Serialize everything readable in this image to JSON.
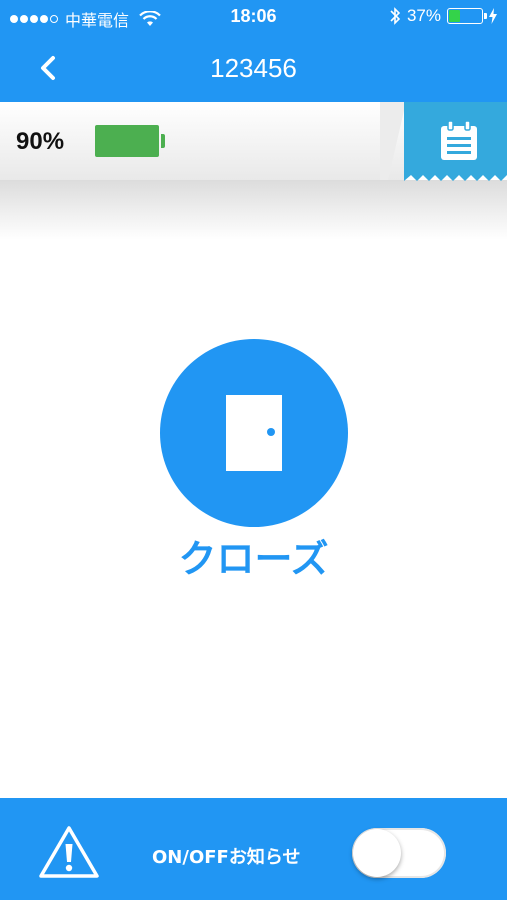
{
  "status_bar": {
    "carrier": "中華電信",
    "time": "18:06",
    "battery_text": "37%",
    "battery_level": 0.37,
    "battery_fill_color": "#34d34a"
  },
  "nav": {
    "title": "123456",
    "back_icon": "chevron-left-icon"
  },
  "device": {
    "battery_percent": "90%",
    "battery_color": "#4caf50",
    "calendar_icon": "calendar-icon"
  },
  "door": {
    "state_label": "クローズ",
    "icon": "door-icon",
    "color": "#2196f3"
  },
  "bottom": {
    "warning_icon": "warning-icon",
    "notify_label": "ON/OFFお知らせ",
    "toggle_on": false
  },
  "theme": {
    "primary": "#2196f3",
    "calendar_tab": "#34a9dd"
  }
}
